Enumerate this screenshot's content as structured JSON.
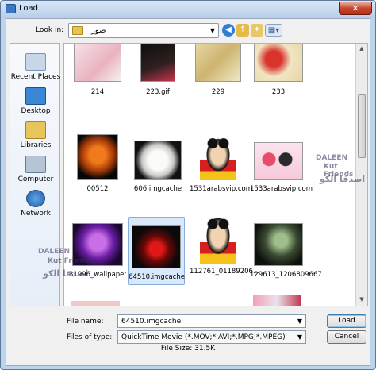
{
  "window": {
    "title": "Load",
    "close_glyph": "✕"
  },
  "toolbar": {
    "lookin_label": "Look in:",
    "lookin_value": "صور",
    "icons": [
      "back-icon",
      "up-folder-icon",
      "new-folder-icon",
      "view-menu-icon"
    ]
  },
  "places": [
    "Recent Places",
    "Desktop",
    "Libraries",
    "Computer",
    "Network"
  ],
  "files": {
    "row0": [
      "214",
      "223.gif",
      "229",
      "233"
    ],
    "row1": [
      "00512",
      "606.imgcache",
      "1531arabsvip.com",
      "1533arabsvip.com"
    ],
    "row2": [
      "31996_wallpaper...",
      "64510.imgcache",
      "112761_01189206...",
      "129613_1206809667"
    ],
    "selected": "64510.imgcache"
  },
  "form": {
    "filename_label": "File name:",
    "filename_value": "64510.imgcache",
    "filetype_label": "Files of type:",
    "filetype_value": "QuickTime Movie (*.MOV;*.AVI;*.MPG;*.MPEG)",
    "load_label": "Load",
    "cancel_label": "Cancel"
  },
  "status": "File Size: 31.5K",
  "watermark": {
    "top": "DALEEN",
    "mid": "Kut Friends",
    "ar": "اصدقا الكو"
  }
}
